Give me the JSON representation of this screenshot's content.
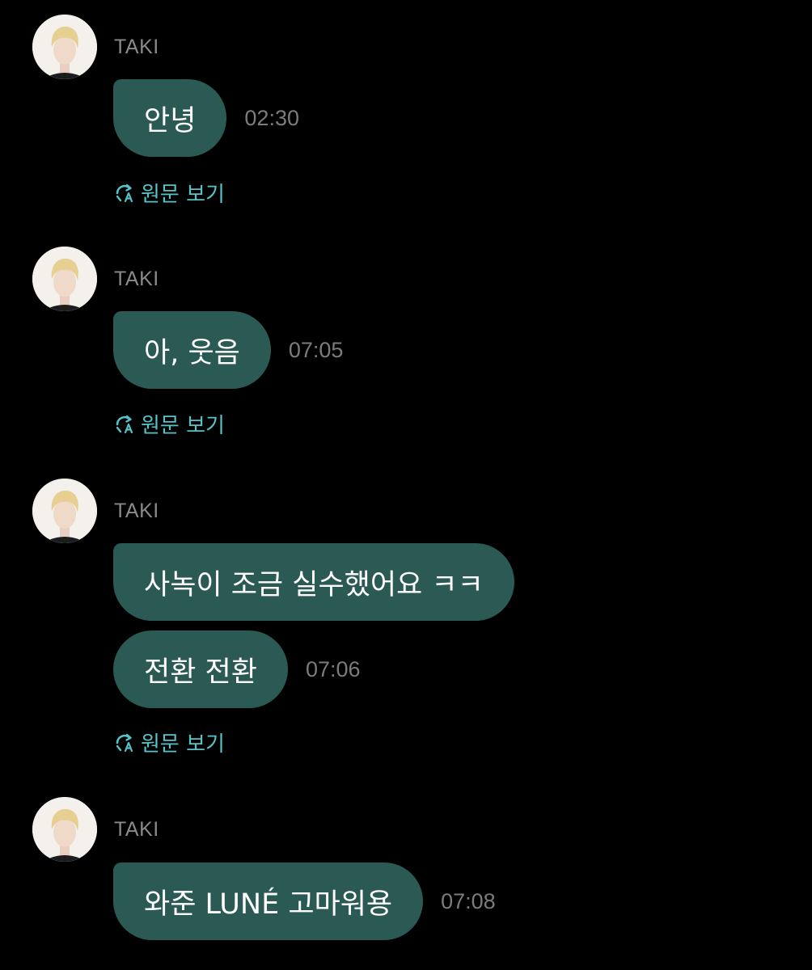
{
  "colors": {
    "background": "#000000",
    "bubble": "#2b5a55",
    "sender_name": "#8a8a8a",
    "timestamp": "#7c7c7c",
    "translate_link": "#57c3c9"
  },
  "messages": [
    {
      "sender": "TAKI",
      "bubbles": [
        "안녕"
      ],
      "time": "02:30",
      "translate_label": "원문 보기"
    },
    {
      "sender": "TAKI",
      "bubbles": [
        "아, 웃음"
      ],
      "time": "07:05",
      "translate_label": "원문 보기"
    },
    {
      "sender": "TAKI",
      "bubbles": [
        "사녹이 조금 실수했어요 ㅋㅋ",
        "전환 전환"
      ],
      "time": "07:06",
      "translate_label": "원문 보기"
    },
    {
      "sender": "TAKI",
      "bubbles": [
        "와준 LUNÉ 고마워용"
      ],
      "time": "07:08"
    }
  ]
}
